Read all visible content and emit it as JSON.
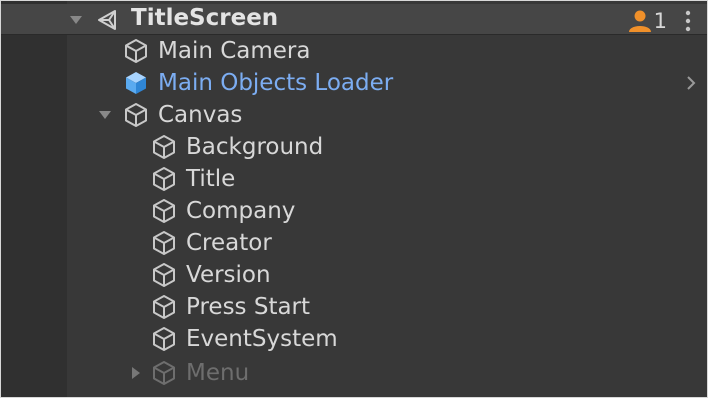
{
  "scene": {
    "name": "TitleScreen",
    "user_count": "1"
  },
  "hierarchy": [
    {
      "label": "Main Camera"
    },
    {
      "label": "Main Objects Loader"
    },
    {
      "label": "Canvas"
    },
    {
      "label": "Background"
    },
    {
      "label": "Title"
    },
    {
      "label": "Company"
    },
    {
      "label": "Creator"
    },
    {
      "label": "Version"
    },
    {
      "label": "Press Start"
    },
    {
      "label": "EventSystem"
    },
    {
      "label": "Menu"
    }
  ],
  "colors": {
    "panel_bg": "#383838",
    "header_bg": "#464646",
    "text": "#d8d8d8",
    "prefab_text": "#7cadf2",
    "inactive_text": "#6e6e6e",
    "user_icon": "#f0902a"
  },
  "icons": {
    "scene": "unity-logo-icon",
    "gameobject": "gameobject-cube-icon",
    "prefab": "prefab-cube-icon",
    "collaborators": "user-icon",
    "menu": "kebab-menu-icon"
  }
}
